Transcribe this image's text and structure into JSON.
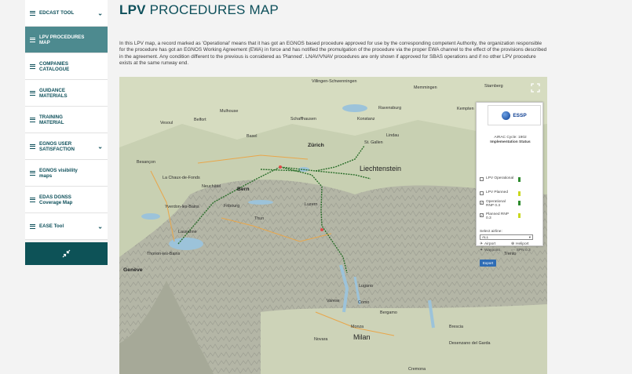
{
  "sidebar": {
    "items": [
      {
        "label": "EDCAST TOOL",
        "chevron": true,
        "active": false
      },
      {
        "label": "LPV PROCEDURES MAP",
        "chevron": false,
        "active": true
      },
      {
        "label": "COMPANIES CATALOGUE",
        "chevron": false,
        "active": false
      },
      {
        "label": "GUIDANCE MATERIALS",
        "chevron": false,
        "active": false
      },
      {
        "label": "TRAINING MATERIAL",
        "chevron": false,
        "active": false
      },
      {
        "label": "EGNOS USER SATISFACTION",
        "chevron": true,
        "active": false
      },
      {
        "label": "EGNOS visibility maps",
        "chevron": false,
        "active": false
      },
      {
        "label": "EDAS DGNSS Coverage Map",
        "chevron": false,
        "active": false
      },
      {
        "label": "EASE Tool",
        "chevron": true,
        "active": false
      }
    ],
    "collapse_icon": "collapse-arrows-icon"
  },
  "header": {
    "title_bold": "LPV",
    "title_rest": " PROCEDURES MAP"
  },
  "intro": "In this LPV map, a record marked as 'Operational' means that it has got an EGNOS based procedure approved for use by the corresponding competent Authority, the organization responsible for the procedure has got an EGNOS Working Agreement (EWA) in force and has notified the promulgation of the procedure via the proper EWA channel to the effect of the provisions described in the agreement. Any condition different to the previous is considered as 'Planned'. LNAV/VNAV procedures are only shown if approved for SBAS operations and if no other LPV procedure exists at the same runway end.",
  "map": {
    "labels": [
      {
        "text": "Villingen-Schwenningen",
        "cls": ""
      },
      {
        "text": "Memmingen",
        "cls": ""
      },
      {
        "text": "Starnberg",
        "cls": ""
      },
      {
        "text": "Mulhouse",
        "cls": ""
      },
      {
        "text": "Ravensburg",
        "cls": ""
      },
      {
        "text": "Kempten",
        "cls": ""
      },
      {
        "text": "Vesoul",
        "cls": ""
      },
      {
        "text": "Belfort",
        "cls": ""
      },
      {
        "text": "Basel",
        "cls": ""
      },
      {
        "text": "Konstanz",
        "cls": ""
      },
      {
        "text": "Lindau",
        "cls": ""
      },
      {
        "text": "Schaffhausen",
        "cls": ""
      },
      {
        "text": "Zürich",
        "cls": "big"
      },
      {
        "text": "St. Gallen",
        "cls": ""
      },
      {
        "text": "Besançon",
        "cls": ""
      },
      {
        "text": "Liechtenstein",
        "cls": "large"
      },
      {
        "text": "La Chaux-de-Fonds",
        "cls": ""
      },
      {
        "text": "Neuchâtel",
        "cls": ""
      },
      {
        "text": "Bern",
        "cls": "big"
      },
      {
        "text": "Luzern",
        "cls": ""
      },
      {
        "text": "Yverdon-les-Bains",
        "cls": ""
      },
      {
        "text": "Fribourg",
        "cls": ""
      },
      {
        "text": "Thun",
        "cls": ""
      },
      {
        "text": "Lausanne",
        "cls": ""
      },
      {
        "text": "Thonon-les-Bains",
        "cls": ""
      },
      {
        "text": "Genève",
        "cls": "big"
      },
      {
        "text": "Lugano",
        "cls": ""
      },
      {
        "text": "Varese",
        "cls": ""
      },
      {
        "text": "Como",
        "cls": ""
      },
      {
        "text": "Bergamo",
        "cls": ""
      },
      {
        "text": "Novara",
        "cls": ""
      },
      {
        "text": "Monza",
        "cls": ""
      },
      {
        "text": "Milan",
        "cls": "large"
      },
      {
        "text": "Brescia",
        "cls": ""
      },
      {
        "text": "Desenzano del Garda",
        "cls": ""
      },
      {
        "text": "Cremona",
        "cls": ""
      },
      {
        "text": "Trento",
        "cls": ""
      }
    ],
    "fullscreen_icon": "fullscreen-icon"
  },
  "panel": {
    "logo_text": "ESSP",
    "cycle_line1": "AIRAC Cycle: 1902",
    "cycle_line2": "Implementation Status",
    "options": [
      {
        "label": "LPV Operational",
        "checked": false,
        "color": "#2e8b2e"
      },
      {
        "label": "LPV Planned",
        "checked": false,
        "color": "#c9d81e"
      },
      {
        "label": "Operational RNP 0.3",
        "checked": true,
        "color": "#2e8b2e"
      },
      {
        "label": "Planned RNP 0.3",
        "checked": true,
        "color": "#c9d81e"
      }
    ],
    "select_label": "Select airline:",
    "select_value": "ALL",
    "legend": [
      {
        "label": "Airport",
        "icon": "airport-icon"
      },
      {
        "label": "Heliport",
        "icon": "heliport-icon"
      },
      {
        "label": "Waypoint",
        "icon": "waypoint-icon"
      },
      {
        "label": "SPN 0.3",
        "icon": "route-icon"
      }
    ],
    "export_label": "Export"
  }
}
